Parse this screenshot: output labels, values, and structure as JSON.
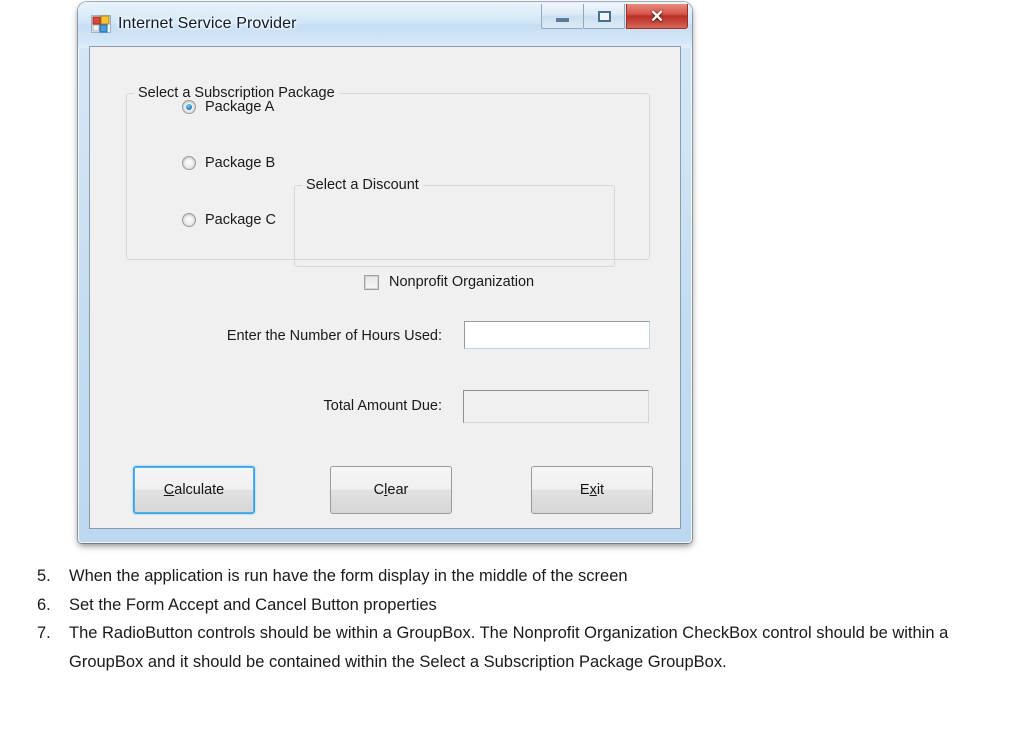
{
  "window": {
    "title": "Internet Service Provider",
    "icon": "visual-studio-form-icon",
    "controls": {
      "minimize": "minimize-icon",
      "maximize": "maximize-icon",
      "close": "✕"
    }
  },
  "form": {
    "subscription_group": {
      "title": "Select a Subscription Package",
      "options": [
        {
          "label": "Package A",
          "selected": true
        },
        {
          "label": "Package B",
          "selected": false
        },
        {
          "label": "Package C",
          "selected": false
        }
      ]
    },
    "discount_group": {
      "title": "Select a Discount",
      "checkbox": {
        "label": "Nonprofit Organization",
        "checked": false
      }
    },
    "fields": [
      {
        "label": "Enter the Number of Hours Used:",
        "value": "",
        "placeholder": "",
        "readonly": false
      },
      {
        "label": "Total Amount Due:",
        "value": "",
        "placeholder": "",
        "readonly": true
      }
    ],
    "buttons": [
      {
        "label": "Calculate",
        "accel": "C",
        "focused": true
      },
      {
        "label": "Clear",
        "accel": "l",
        "focused": false
      },
      {
        "label": "Exit",
        "accel": "x",
        "focused": false
      }
    ]
  },
  "instructions": [
    {
      "number": "5.",
      "text": "When the application is run have the form display in the middle of the screen"
    },
    {
      "number": "6.",
      "text": "Set the Form Accept and Cancel Button properties"
    },
    {
      "number": "7.",
      "text": "The RadioButton controls should be within a GroupBox. The Nonprofit Organization CheckBox control should be within a GroupBox and it should be contained within the Select a Subscription Package GroupBox."
    }
  ],
  "colors": {
    "accent_focus": "#3c9fe0",
    "close_button": "#bb2f26",
    "form_background": "#f0f0f0",
    "titlebar": "#cfe4f6",
    "radio_dot": "#2b8fd4"
  }
}
